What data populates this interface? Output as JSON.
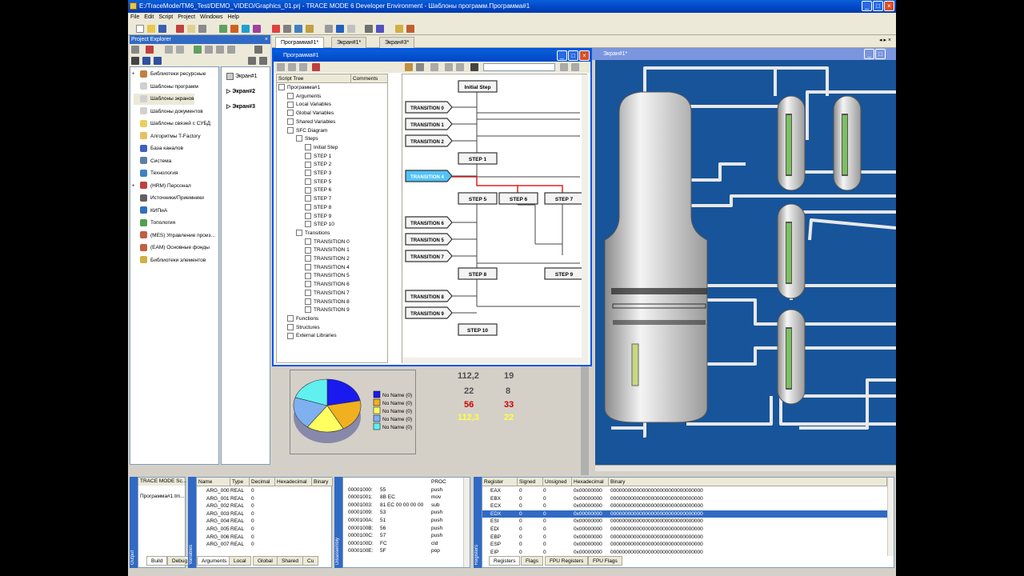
{
  "window": {
    "title": "E:/TraceMode/TM6_Test/DEMO_VIDEO/Graphics_01.prj - TRACE MODE 6 Developer Environment - Шаблоны программ.Программа#1",
    "min": "_",
    "max": "□",
    "close": "×"
  },
  "menu": [
    "File",
    "Edit",
    "Script",
    "Project",
    "Windows",
    "Help"
  ],
  "project_explorer": {
    "title": "Project Explorer",
    "close": "×",
    "items": [
      "Библиотеки ресурсные",
      "Шаблоны программ",
      "Шаблоны экранов",
      "Шаблоны документов",
      "Шаблоны связей с СУБД",
      "Алгоритмы T-Factory",
      "База каналов",
      "Система",
      "Технология",
      "(HRM) Персонал",
      "Источники/Приемники",
      "КИПиА",
      "Топология",
      "(MES) Управление произ...",
      "(EAM) Основные фонды",
      "Библиотеки элементов"
    ],
    "screens": [
      "Экран#1",
      "Экран#2",
      "Экран#3"
    ]
  },
  "tabs": [
    "Программа#1*",
    "Экран#1*",
    "Экран#3*"
  ],
  "tab_controls": "◂ ▸ ×",
  "program_window": {
    "title": "Программа#1",
    "tree_header_1": "Script Tree",
    "tree_header_2": "Comments",
    "tree": [
      "Программа#1",
      "Arguments",
      "Local Variables",
      "Global Variables",
      "Shared Variables",
      "SFC Diagram",
      "Steps",
      "Initial Step",
      "STEP 1",
      "STEP 2",
      "STEP 3",
      "STEP 5",
      "STEP 6",
      "STEP 7",
      "STEP 8",
      "STEP 9",
      "STEP 10",
      "Transitions",
      "TRANSITION 0",
      "TRANSITION 1",
      "TRANSITION 2",
      "TRANSITION 4",
      "TRANSITION 5",
      "TRANSITION 6",
      "TRANSITION 7",
      "TRANSITION 8",
      "TRANSITION 9",
      "Functions",
      "Structures",
      "External Libraries"
    ],
    "sfc": {
      "steps": [
        "Initial Step",
        "STEP 1",
        "STEP 5",
        "STEP 6",
        "STEP 7",
        "STEP 8",
        "STEP 9",
        "STEP 10"
      ],
      "transitions": [
        "TRANSITION 0",
        "TRANSITION 1",
        "TRANSITION 2",
        "TRANSITION 4",
        "TRANSITION 6",
        "TRANSITION 5",
        "TRANSITION 7",
        "TRANSITION 8",
        "TRANSITION 9"
      ],
      "active_transition_color": "#4fc3f7",
      "active_link_color": "#e02020"
    }
  },
  "graphics": {
    "legend": [
      "No Name (0)",
      "No Name (0)",
      "No Name (0)",
      "No Name (0)",
      "No Name (0)"
    ],
    "legend_colors": [
      "#1a1aee",
      "#f0b020",
      "#ffff60",
      "#7fb0f0",
      "#60f0f0"
    ],
    "pie_values": [
      22,
      20,
      18,
      20,
      20
    ],
    "numbers": [
      {
        "v": "112,2",
        "c": "#505050"
      },
      {
        "v": "19",
        "c": "#505050"
      },
      {
        "v": "22",
        "c": "#505050"
      },
      {
        "v": "8",
        "c": "#505050"
      },
      {
        "v": "56",
        "c": "#cc0000"
      },
      {
        "v": "33",
        "c": "#cc0000"
      },
      {
        "v": "112,3",
        "c": "#ffff40"
      },
      {
        "v": "22",
        "c": "#ffff40"
      }
    ]
  },
  "mimic": {
    "title": "Экран#1*",
    "bg": "#17549a"
  },
  "output": {
    "label": "Output",
    "lines": [
      "TRACE MODE Sc...",
      "Программа#1.tm..."
    ],
    "tabs": [
      "Build",
      "Debug"
    ]
  },
  "variables": {
    "label": "Variables",
    "headers": [
      "Name",
      "Type",
      "Decimal",
      "Hexadecimal",
      "Binary"
    ],
    "rows": [
      [
        "ARG_000",
        "REAL",
        "0"
      ],
      [
        "ARG_001",
        "REAL",
        "0"
      ],
      [
        "ARG_002",
        "REAL",
        "0"
      ],
      [
        "ARG_003",
        "REAL",
        "0"
      ],
      [
        "ARG_004",
        "REAL",
        "0"
      ],
      [
        "ARG_005",
        "REAL",
        "0"
      ],
      [
        "ARG_006",
        "REAL",
        "0"
      ],
      [
        "ARG_007",
        "REAL",
        "0"
      ]
    ],
    "tabs": [
      "Arguments",
      "Local",
      "Global",
      "Shared",
      "Cu"
    ]
  },
  "disassembly": {
    "label": "Disassembly",
    "rows": [
      [
        "",
        "",
        "PROC"
      ],
      [
        "00001000:",
        "55",
        "push"
      ],
      [
        "00001001:",
        "8B EC",
        "mov"
      ],
      [
        "00001003:",
        "81 EC 00 00 00 00",
        "sub"
      ],
      [
        "00001009:",
        "53",
        "push"
      ],
      [
        "0000100A:",
        "51",
        "push"
      ],
      [
        "0000100B:",
        "56",
        "push"
      ],
      [
        "0000100C:",
        "57",
        "push"
      ],
      [
        "0000100D:",
        "FC",
        "cld"
      ],
      [
        "0000100E:",
        "5F",
        "pop"
      ]
    ]
  },
  "registers": {
    "label": "Registers",
    "headers": [
      "Register",
      "Signed",
      "Unsigned",
      "Hexadecimal",
      "Binary"
    ],
    "rows": [
      [
        "EAX",
        "0",
        "0",
        "0x00000000",
        "00000000000000000000000000000000"
      ],
      [
        "EBX",
        "0",
        "0",
        "0x00000000",
        "00000000000000000000000000000000"
      ],
      [
        "ECX",
        "0",
        "0",
        "0x00000000",
        "00000000000000000000000000000000"
      ],
      [
        "EDX",
        "0",
        "0",
        "0x00000000",
        "00000000000000000000000000000000"
      ],
      [
        "ESI",
        "0",
        "0",
        "0x00000000",
        "00000000000000000000000000000000"
      ],
      [
        "EDI",
        "0",
        "0",
        "0x00000000",
        "00000000000000000000000000000000"
      ],
      [
        "EBP",
        "0",
        "0",
        "0x00000000",
        "00000000000000000000000000000000"
      ],
      [
        "ESP",
        "0",
        "0",
        "0x00000000",
        "00000000000000000000000000000000"
      ],
      [
        "EIP",
        "0",
        "0",
        "0x00000000",
        "00000000000000000000000000000000"
      ]
    ],
    "tabs": [
      "Registers",
      "Flags",
      "FPU Registers",
      "FPU Flags"
    ]
  }
}
